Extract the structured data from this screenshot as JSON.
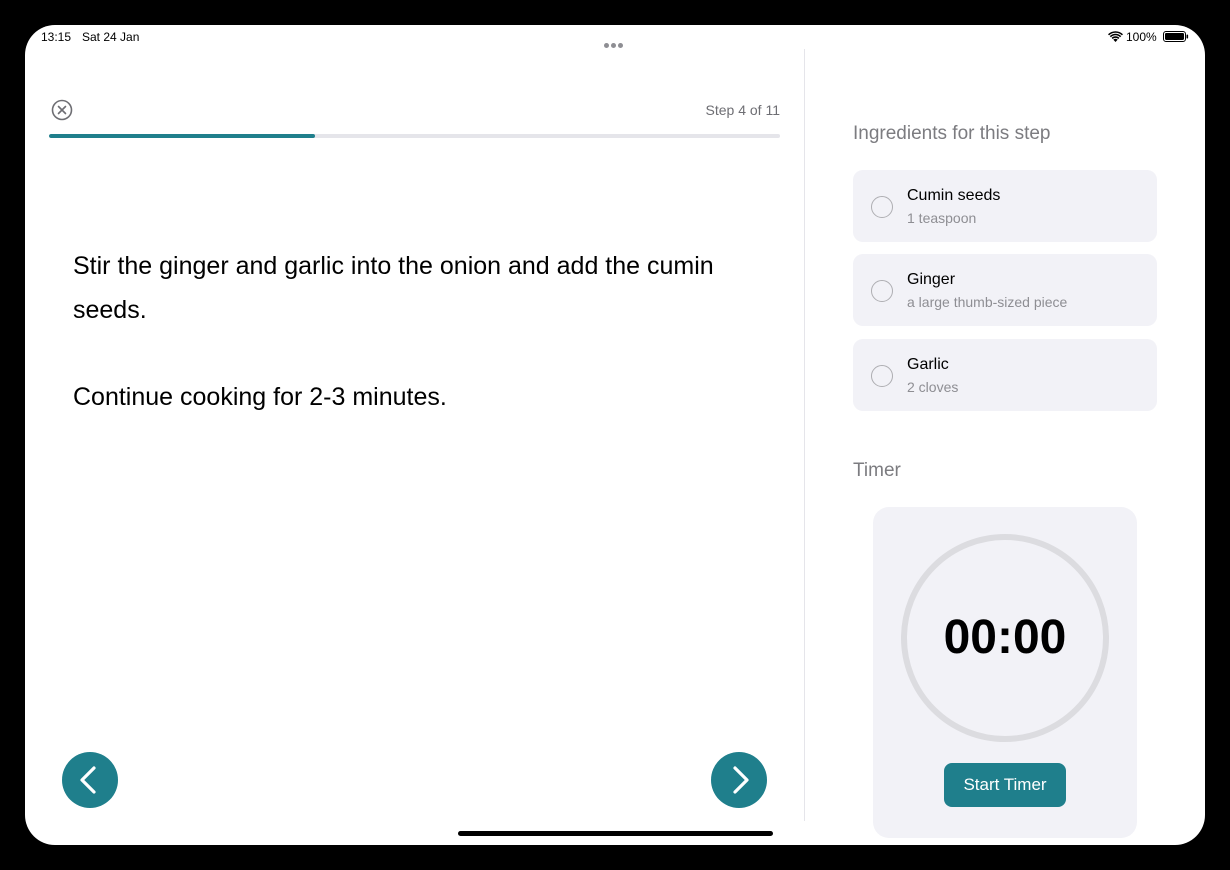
{
  "status_bar": {
    "time": "13:15",
    "date": "Sat 24 Jan",
    "battery": "100%"
  },
  "step": {
    "counter": "Step 4 of 11",
    "progress_fraction": 0.364,
    "instructions": [
      "Stir the ginger and garlic into the onion and add the cumin seeds.",
      "Continue cooking for 2-3 minutes."
    ]
  },
  "ingredients": {
    "heading": "Ingredients for this step",
    "items": [
      {
        "name": "Cumin seeds",
        "quantity": "1 teaspoon",
        "checked": false
      },
      {
        "name": "Ginger",
        "quantity": "a large thumb-sized piece",
        "checked": false
      },
      {
        "name": "Garlic",
        "quantity": "2 cloves",
        "checked": false
      }
    ]
  },
  "timer": {
    "heading": "Timer",
    "display": "00:00",
    "start_label": "Start Timer"
  },
  "icons": {
    "close": "close-circle-icon",
    "previous": "chevron-left-icon",
    "next": "chevron-right-icon",
    "wifi": "wifi-icon",
    "battery": "battery-icon"
  },
  "colors": {
    "accent": "#1f7f8c",
    "card_background": "#f2f2f7",
    "secondary_text": "#7c7c80"
  }
}
